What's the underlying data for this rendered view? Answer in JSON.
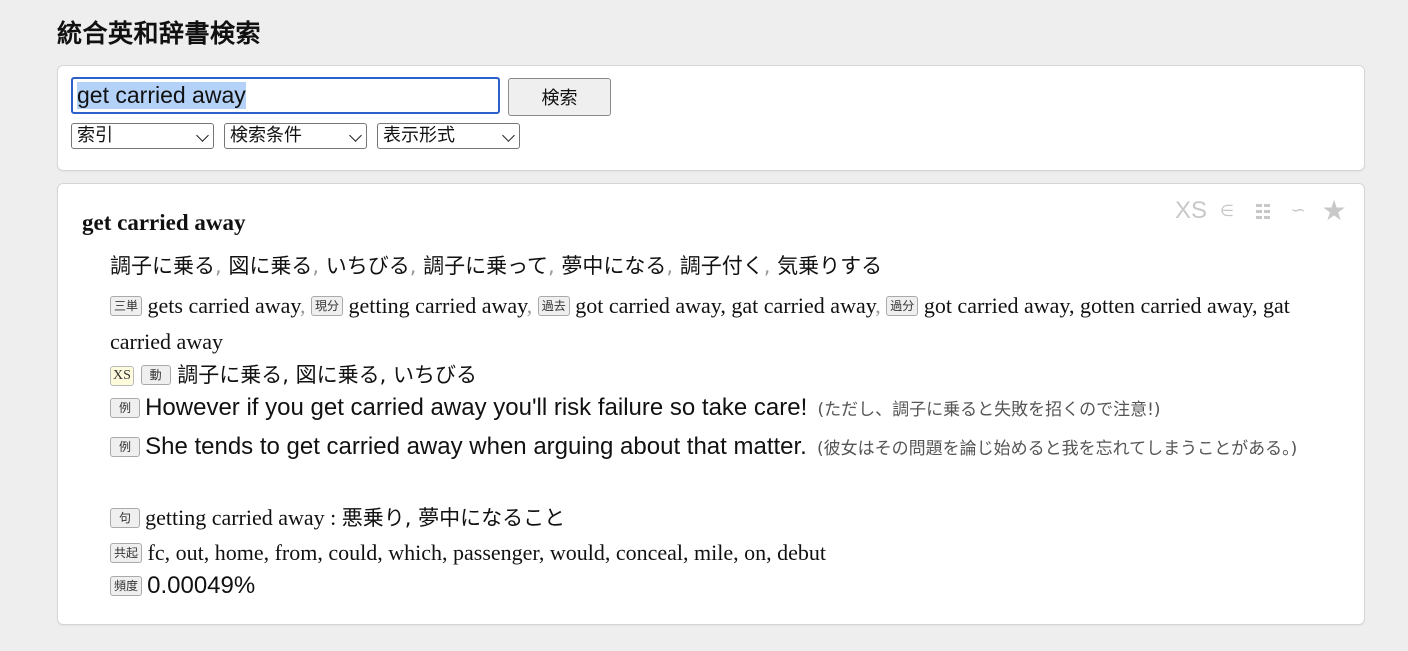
{
  "app": {
    "title": "統合英和辞書検索"
  },
  "search": {
    "query": "get carried away",
    "button_label": "検索",
    "selects": [
      {
        "value": "索引"
      },
      {
        "value": "検索条件"
      },
      {
        "value": "表示形式"
      }
    ]
  },
  "toolbar": {
    "items": [
      {
        "icon": "xs-icon",
        "glyph": "XS"
      },
      {
        "icon": "element-of-icon",
        "glyph": "∈"
      },
      {
        "icon": "grid-icon",
        "glyph": ""
      },
      {
        "icon": "link-icon",
        "glyph": "∽"
      },
      {
        "icon": "star-icon",
        "glyph": "★"
      }
    ]
  },
  "entry": {
    "headword": "get carried away",
    "translations": [
      "調子に乗る",
      "図に乗る",
      "いちびる",
      "調子に乗って",
      "夢中になる",
      "調子付く",
      "気乗りする"
    ],
    "inflections": [
      {
        "badge": "三単",
        "forms": "gets carried away"
      },
      {
        "badge": "現分",
        "forms": "getting carried away"
      },
      {
        "badge": "過去",
        "forms": "got carried away, gat carried away"
      },
      {
        "badge": "過分",
        "forms": "got carried away, gotten carried away, gat carried away"
      }
    ],
    "sense": {
      "level_badge": "XS",
      "pos_badge": "動",
      "text": "調子に乗る, 図に乗る, いちびる"
    },
    "examples": [
      {
        "badge": "例",
        "en": "However if you get carried away you'll risk failure so take care!",
        "ja": "(ただし、調子に乗ると失敗を招くので注意!)"
      },
      {
        "badge": "例",
        "en": "She tends to get carried away when arguing about that matter.",
        "ja": "(彼女はその問題を論じ始めると我を忘れてしまうことがある。)"
      }
    ],
    "phrase": {
      "badge": "句",
      "en": "getting carried away",
      "sep": " : ",
      "ja": "悪乗り, 夢中になること"
    },
    "cooccurrence": {
      "badge": "共起",
      "text": "fc, out, home, from, could, which, passenger, would, conceal, mile, on, debut"
    },
    "frequency": {
      "badge": "頻度",
      "value": "0.00049%"
    }
  },
  "colors": {
    "background": "#eeeeee",
    "panel": "#ffffff",
    "focus_ring": "#2b5fc9",
    "selection": "#b4d2f7",
    "toolbar_icon": "#c8c8c8",
    "xs_badge_bg": "#fdfbdc"
  }
}
